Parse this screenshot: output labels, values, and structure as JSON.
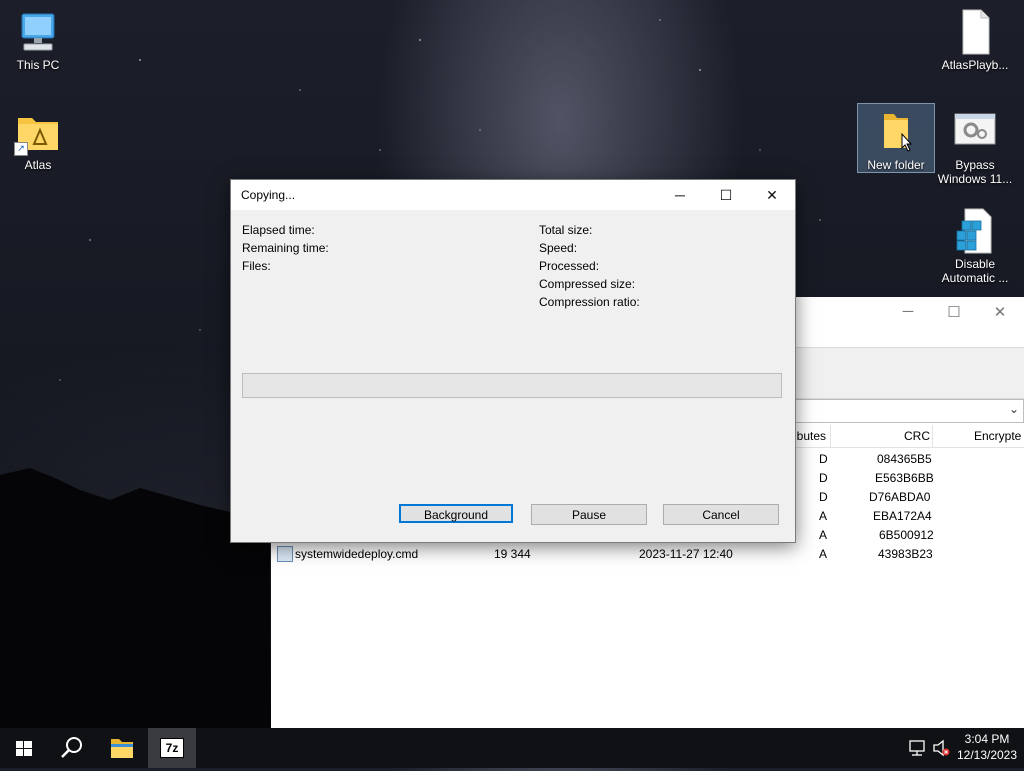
{
  "desktop": {
    "icons": [
      {
        "label": "This PC"
      },
      {
        "label": "Atlas"
      },
      {
        "label": "AtlasPlayb..."
      },
      {
        "label": "New folder"
      },
      {
        "label": "Bypass Windows 11..."
      },
      {
        "label": "Disable Automatic ..."
      }
    ]
  },
  "file_manager": {
    "columns": {
      "attributes": "ributes",
      "crc": "CRC",
      "encrypted": "Encrypte"
    },
    "rows": [
      {
        "name": "",
        "size": "",
        "modified": "",
        "attributes": "D",
        "crc": "084365B5"
      },
      {
        "name": "",
        "size": "",
        "modified": "",
        "attributes": "D",
        "crc": "E563B6BB"
      },
      {
        "name": "",
        "size": "",
        "modified": "",
        "attributes": "D",
        "crc": "D76ABDA0"
      },
      {
        "name": "",
        "size": "",
        "modified": "",
        "attributes": "A",
        "crc": "EBA172A4"
      },
      {
        "name": "",
        "size": "",
        "modified": "",
        "attributes": "A",
        "crc": "6B500912"
      },
      {
        "name": "systemwidedeploy.cmd",
        "size": "19 344",
        "modified": "2023-11-27 12:40",
        "attributes": "A",
        "crc": "43983B23"
      }
    ]
  },
  "dialog": {
    "title": "Copying...",
    "labels_left": {
      "elapsed": "Elapsed time:",
      "remaining": "Remaining time:",
      "files": "Files:"
    },
    "labels_right": {
      "total": "Total size:",
      "speed": "Speed:",
      "processed": "Processed:",
      "compressed": "Compressed size:",
      "ratio": "Compression ratio:"
    },
    "progress": 0,
    "buttons": {
      "background": "Background",
      "pause": "Pause",
      "cancel": "Cancel"
    }
  },
  "taskbar": {
    "time": "3:04 PM",
    "date": "12/13/2023",
    "active_app_label": "7z"
  },
  "colors": {
    "accent": "#0078d7",
    "taskbar": "#101114",
    "dialog_bg": "#f0f0f0"
  }
}
